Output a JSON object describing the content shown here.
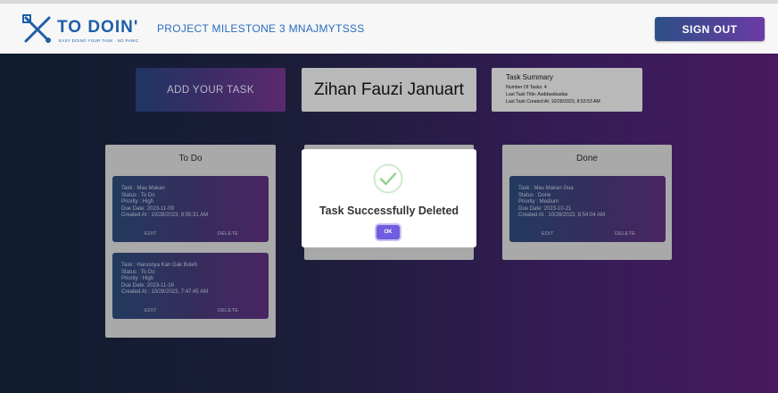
{
  "header": {
    "logo_text": "TO DOIN'",
    "logo_tagline": "EASY DOING YOUR TASK · NO PANIC",
    "project_title": "PROJECT MILESTONE 3 MNAJMYTSSS",
    "signout_label": "SIGN OUT"
  },
  "toolbar": {
    "add_task_label": "ADD YOUR TASK",
    "user_name": "Zihan Fauzi Januart"
  },
  "summary": {
    "title": "Task Summary",
    "lines": [
      "Number Of Tasks: 4",
      "Last Task Title: Asddasdsadas",
      "Last Task Created At: 10/28/2023, 8:53:53 AM"
    ]
  },
  "columns": {
    "todo": {
      "title": "To Do",
      "tasks": [
        {
          "lines": [
            "Task : Mau Makan",
            "Status : To Do",
            "Priority : High",
            "Due Date: 2023-11-09",
            "Created At : 10/28/2023, 9:55:31 AM"
          ],
          "edit_label": "EDIT",
          "delete_label": "DELETE"
        },
        {
          "lines": [
            "Task : Harusnya Kan Gak Boleh",
            "Status : To Do",
            "Priority : High",
            "Due Date: 2023-11-16",
            "Created At : 10/28/2023, 7:47:45 AM"
          ],
          "edit_label": "EDIT",
          "delete_label": "DELETE"
        }
      ]
    },
    "done": {
      "title": "Done",
      "tasks": [
        {
          "lines": [
            "Task : Mau Makan Gua",
            "Status : Done",
            "Priority : Medium",
            "Due Date: 2023-10-21",
            "Created At : 10/28/2023, 8:54:04 AM"
          ],
          "edit_label": "EDIT",
          "delete_label": "DELETE"
        }
      ]
    }
  },
  "modal": {
    "icon": "check-circle-icon",
    "title": "Task Successfully Deleted",
    "ok_label": "OK"
  },
  "colors": {
    "brand_blue": "#1d5fa8",
    "accent_purple": "#6f5ce0",
    "success_green": "#8fd18b"
  }
}
